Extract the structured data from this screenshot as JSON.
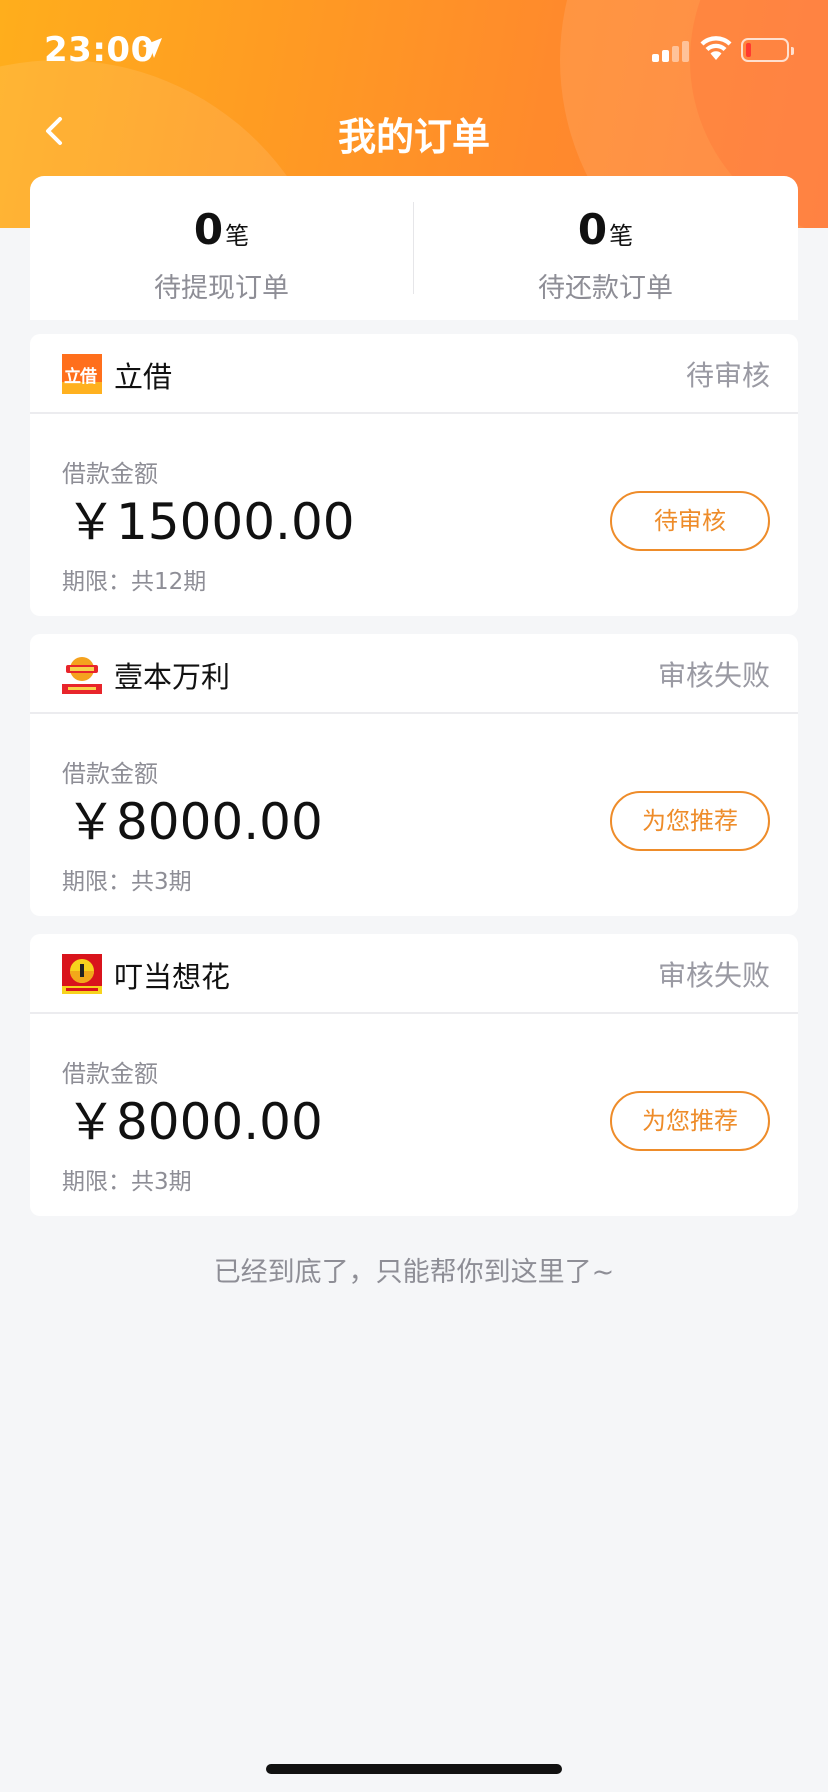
{
  "status_bar": {
    "time": "23:00"
  },
  "nav": {
    "title": "我的订单"
  },
  "summary": {
    "withdraw": {
      "count": "0",
      "unit": "笔",
      "label": "待提现订单"
    },
    "repay": {
      "count": "0",
      "unit": "笔",
      "label": "待还款订单"
    }
  },
  "orders": [
    {
      "name": "立借",
      "status": "待审核",
      "logo_text": "立借",
      "amount_label": "借款金额",
      "amount": "￥15000.00",
      "period": "期限：共12期",
      "button_label": "待审核"
    },
    {
      "name": "壹本万利",
      "status": "审核失败",
      "amount_label": "借款金额",
      "amount": "￥8000.00",
      "period": "期限：共3期",
      "button_label": "为您推荐"
    },
    {
      "name": "叮当想花",
      "status": "审核失败",
      "amount_label": "借款金额",
      "amount": "￥8000.00",
      "period": "期限：共3期",
      "button_label": "为您推荐"
    }
  ],
  "footer": {
    "note": "已经到底了，只能帮你到这里了~"
  },
  "colors": {
    "accent": "#ee8c2a",
    "header_start": "#ffae1c",
    "header_end": "#ff7f36",
    "muted_text": "#8e8e96"
  }
}
